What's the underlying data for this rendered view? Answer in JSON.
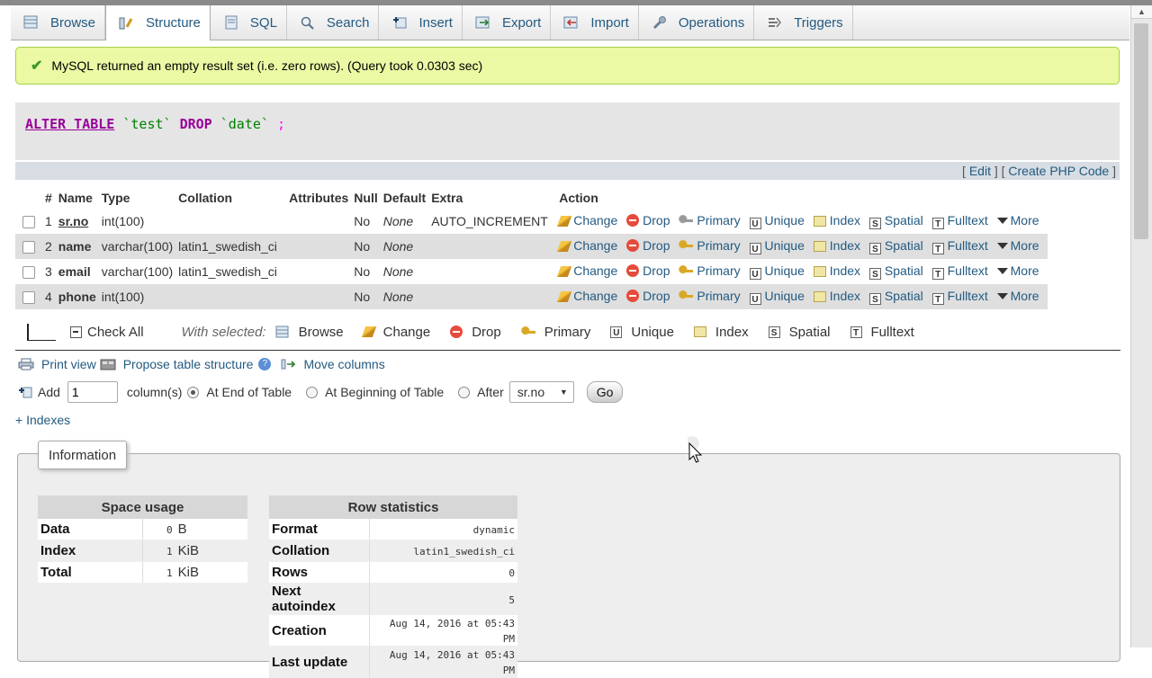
{
  "tabs": [
    {
      "label": "Browse",
      "icon": "browse-icon"
    },
    {
      "label": "Structure",
      "icon": "structure-icon",
      "active": true
    },
    {
      "label": "SQL",
      "icon": "sql-icon"
    },
    {
      "label": "Search",
      "icon": "search-icon"
    },
    {
      "label": "Insert",
      "icon": "insert-icon"
    },
    {
      "label": "Export",
      "icon": "export-icon"
    },
    {
      "label": "Import",
      "icon": "import-icon"
    },
    {
      "label": "Operations",
      "icon": "operations-icon"
    },
    {
      "label": "Triggers",
      "icon": "triggers-icon"
    }
  ],
  "message": {
    "text": "MySQL returned an empty result set (i.e. zero rows). (Query took 0.0303 sec)",
    "color": "#ebf8a4"
  },
  "sql": {
    "kw1": "ALTER TABLE",
    "table": "`test`",
    "kw2": "DROP",
    "column": "`date`",
    "end": ";",
    "edit_link": "Edit",
    "php_link": "Create PHP Code"
  },
  "structure": {
    "headers": [
      "#",
      "Name",
      "Type",
      "Collation",
      "Attributes",
      "Null",
      "Default",
      "Extra",
      "Action"
    ],
    "rows": [
      {
        "num": "1",
        "name": "sr.no",
        "type": "int(100)",
        "collation": "",
        "attributes": "",
        "null": "No",
        "default": "None",
        "extra": "AUTO_INCREMENT"
      },
      {
        "num": "2",
        "name": "name",
        "type": "varchar(100)",
        "collation": "latin1_swedish_ci",
        "attributes": "",
        "null": "No",
        "default": "None",
        "extra": ""
      },
      {
        "num": "3",
        "name": "email",
        "type": "varchar(100)",
        "collation": "latin1_swedish_ci",
        "attributes": "",
        "null": "No",
        "default": "None",
        "extra": ""
      },
      {
        "num": "4",
        "name": "phone",
        "type": "int(100)",
        "collation": "",
        "attributes": "",
        "null": "No",
        "default": "None",
        "extra": ""
      }
    ],
    "actions": {
      "change": "Change",
      "drop": "Drop",
      "primary": "Primary",
      "unique": "Unique",
      "index": "Index",
      "spatial": "Spatial",
      "fulltext": "Fulltext",
      "more": "More"
    }
  },
  "with_selected": {
    "check_all": "Check All",
    "label": "With selected:",
    "browse": "Browse",
    "change": "Change",
    "drop": "Drop",
    "primary": "Primary",
    "unique": "Unique",
    "index": "Index",
    "spatial": "Spatial",
    "fulltext": "Fulltext"
  },
  "tools": {
    "print_view": "Print view",
    "propose": "Propose table structure",
    "move_columns": "Move columns"
  },
  "add_columns": {
    "add_label": "Add",
    "count": "1",
    "columns_label": "column(s)",
    "at_end": "At End of Table",
    "at_beginning": "At Beginning of Table",
    "after": "After",
    "after_select": "sr.no",
    "go": "Go"
  },
  "indexes_link": "+ Indexes",
  "information": {
    "legend": "Information",
    "space_usage": {
      "title": "Space usage",
      "rows": [
        {
          "label": "Data",
          "value": "0",
          "unit": "B"
        },
        {
          "label": "Index",
          "value": "1",
          "unit": "KiB"
        },
        {
          "label": "Total",
          "value": "1",
          "unit": "KiB"
        }
      ]
    },
    "row_statistics": {
      "title": "Row statistics",
      "rows": [
        {
          "label": "Format",
          "value": "dynamic"
        },
        {
          "label": "Collation",
          "value": "latin1_swedish_ci"
        },
        {
          "label": "Rows",
          "value": "0"
        },
        {
          "label": "Next autoindex",
          "value": "5"
        },
        {
          "label": "Creation",
          "value": "Aug 14, 2016 at 05:43 PM"
        },
        {
          "label": "Last update",
          "value": "Aug 14, 2016 at 05:43 PM"
        }
      ]
    }
  }
}
